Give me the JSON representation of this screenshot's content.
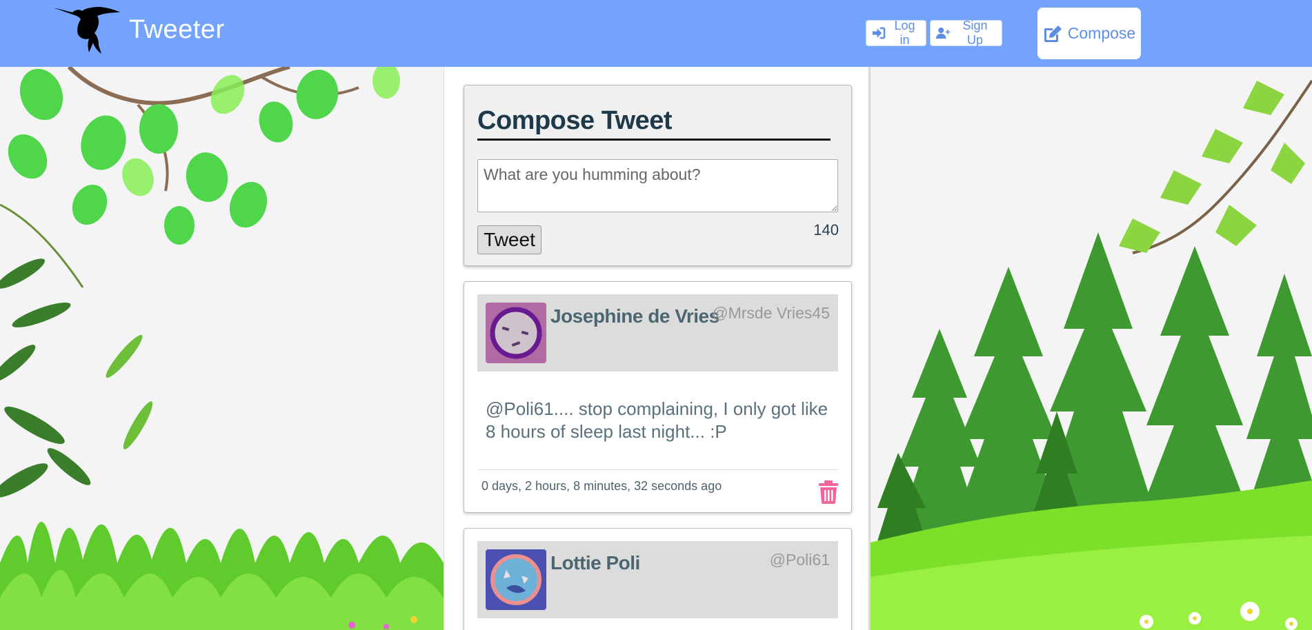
{
  "app": {
    "title": "Tweeter",
    "accent": "#74a3fd"
  },
  "nav": {
    "login_label": "Log in",
    "signup_label": "Sign Up",
    "compose_label": "Compose"
  },
  "compose": {
    "heading": "Compose Tweet",
    "placeholder": "What are you humming about?",
    "submit_label": "Tweet",
    "char_count": "140"
  },
  "tweets": [
    {
      "name": "Josephine de Vries",
      "handle": "@Mrsde Vries45",
      "body": "@Poli61.... stop complaining, I only got like 8 hours of sleep last night... :P",
      "time": "0 days, 2 hours, 8 minutes, 32 seconds ago",
      "avatar_icon": "sleepy-face-avatar-icon"
    },
    {
      "name": "Lottie Poli",
      "handle": "@Poli61",
      "avatar_icon": "blob-face-avatar-icon"
    }
  ]
}
